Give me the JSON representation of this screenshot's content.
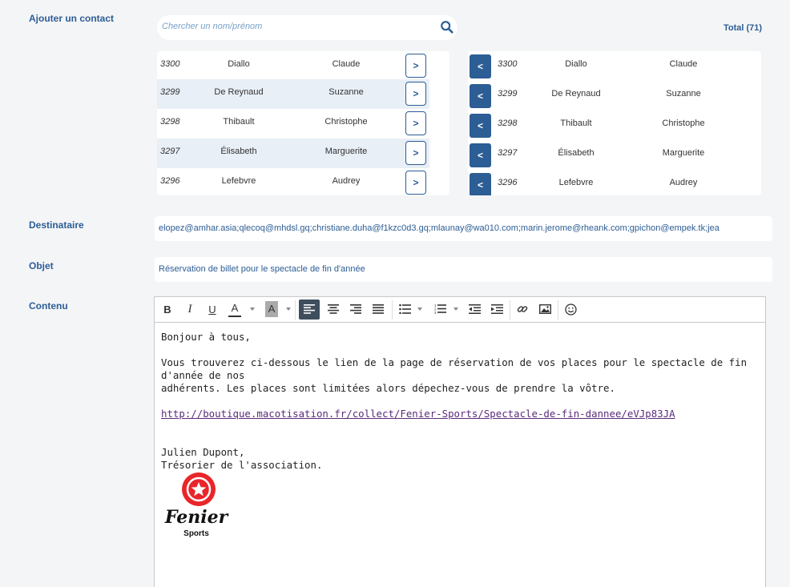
{
  "labels": {
    "add_contact": "Ajouter un contact",
    "recipient": "Destinataire",
    "subject": "Objet",
    "content": "Contenu"
  },
  "search": {
    "placeholder": "Chercher un nom/prénom"
  },
  "total": "Total (71)",
  "add_button_label": ">",
  "remove_button_label": "<",
  "available_contacts": [
    {
      "id": "3300",
      "last": "Diallo",
      "first": "Claude"
    },
    {
      "id": "3299",
      "last": "De Reynaud",
      "first": "Suzanne"
    },
    {
      "id": "3298",
      "last": "Thibault",
      "first": "Christophe"
    },
    {
      "id": "3297",
      "last": "Élisabeth",
      "first": "Marguerite"
    },
    {
      "id": "3296",
      "last": "Lefebvre",
      "first": "Audrey"
    }
  ],
  "selected_contacts": [
    {
      "id": "3300",
      "last": "Diallo",
      "first": "Claude"
    },
    {
      "id": "3299",
      "last": "De Reynaud",
      "first": "Suzanne"
    },
    {
      "id": "3298",
      "last": "Thibault",
      "first": "Christophe"
    },
    {
      "id": "3297",
      "last": "Élisabeth",
      "first": "Marguerite"
    },
    {
      "id": "3296",
      "last": "Lefebvre",
      "first": "Audrey"
    }
  ],
  "recipient_value": "elopez@amhar.asia;qlecoq@mhdsl.gq;christiane.duha@f1kzc0d3.gq;mlaunay@wa010.com;marin.jerome@rheank.com;gpichon@empek.tk;jea",
  "subject_value": "Réservation de billet pour le spectacle de fin d'année",
  "toolbar": {
    "bold": "B",
    "italic": "I",
    "underline": "U",
    "font_color": "A",
    "bg_color": "A"
  },
  "body": {
    "greeting": "Bonjour à tous,",
    "para_line1": "Vous trouverez ci-dessous le lien de la page de réservation de vos places pour le spectacle de fin d'année de nos",
    "para_line2": "adhérents. Les places sont limitées alors dépechez-vous de prendre la vôtre.",
    "link": "http://boutique.macotisation.fr/collect/Fenier-Sports/Spectacle-de-fin-dannee/eVJp83JA",
    "signature_name": "Julien Dupont,",
    "signature_role": "Trésorier de l'association."
  },
  "logo": {
    "name": "Fenier",
    "sub": "Sports",
    "color": "#e8262a"
  },
  "colors": {
    "accent": "#2c5d95",
    "row_alt": "#e8eff6",
    "link": "#5a2b7a"
  }
}
